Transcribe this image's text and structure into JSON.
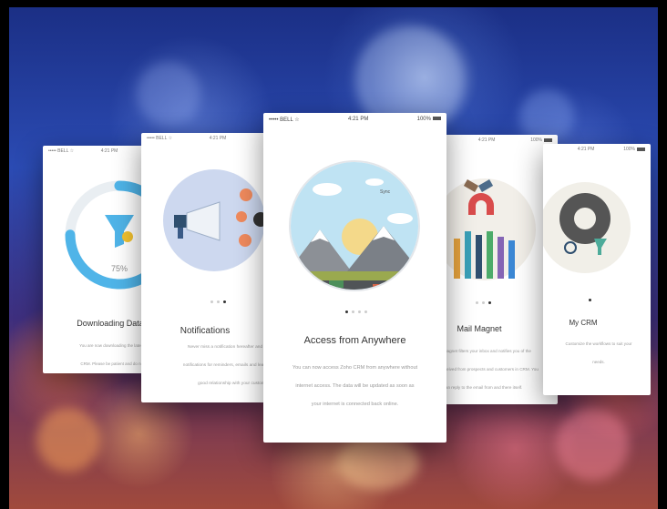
{
  "cards": [
    {
      "status": {
        "carrier": "••••• BELL ☆",
        "time": "4:21 PM",
        "battery": ""
      },
      "title": "Downloading Data",
      "progress_label": "75%",
      "progress": 0.75,
      "desc": [
        "You are now downloading the latest version of your",
        "CRM. Please be patient and do not close the app."
      ]
    },
    {
      "status": {
        "carrier": "••••• BELL ☆",
        "time": "4:21 PM",
        "battery": ""
      },
      "title": "Notifications",
      "desc": [
        "Never miss a notification hereafter and get timely",
        "notifications for reminders, emails and leads to build a",
        "good relationship with your customers."
      ]
    },
    {
      "status": {
        "carrier": "••••• BELL ☆",
        "time": "4:21 PM",
        "battery": "100%"
      },
      "title": "Access from Anywhere",
      "illustration_label": "Sync",
      "desc": [
        "You can now access Zoho CRM from anywhere without",
        "internet access. The data will be updated as soon as",
        "your internet is connected back online."
      ]
    },
    {
      "status": {
        "carrier": "",
        "time": "4:21 PM",
        "battery": "100%"
      },
      "title": "Mail Magnet",
      "desc": [
        "Mail Magnet filters your inbox and notifies you of the",
        "emails received from prospects and customers in CRM. You",
        "can reply to the email from and there itself."
      ]
    },
    {
      "status": {
        "carrier": "",
        "time": "4:21 PM",
        "battery": "100%"
      },
      "title": "My CRM",
      "desc": [
        "Customize the workflows to suit your",
        "needs."
      ]
    }
  ],
  "colors": {
    "accent_blue": "#4fb4e8",
    "funnel_yellow": "#f2c230",
    "illustration_bg": "#cdd8ef",
    "sky": "#bfe3f3"
  }
}
